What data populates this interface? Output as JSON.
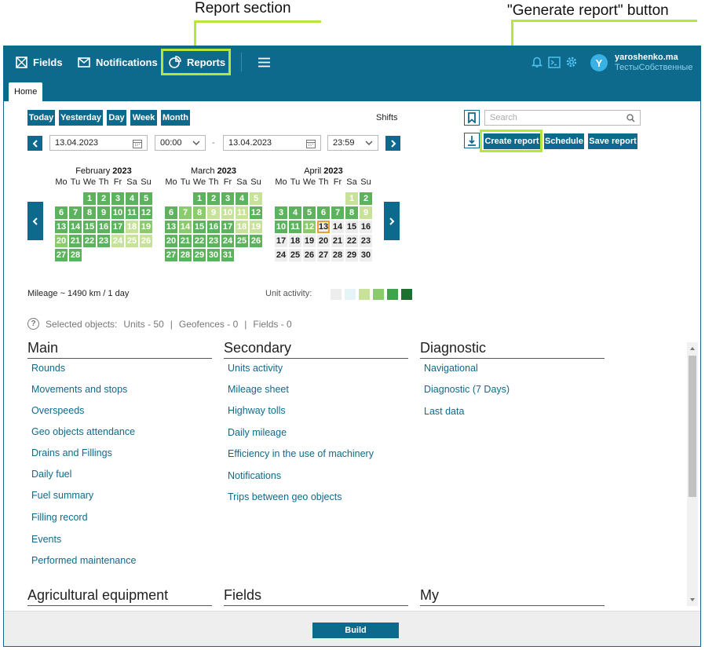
{
  "annotations": {
    "report_section": "Report section",
    "generate_button": "\"Generate report\" button"
  },
  "colors": {
    "brand": "#0e6a8c",
    "highlight": "#b6e53c",
    "activity_levels": [
      "#ededed",
      "#e4f4f7",
      "#c9e29a",
      "#8ccb6b",
      "#3ea34a",
      "#1f6f2f"
    ]
  },
  "topbar": {
    "nav": [
      {
        "label": "Fields",
        "icon": "fields-icon"
      },
      {
        "label": "Notifications",
        "icon": "envelope-icon"
      },
      {
        "label": "Reports",
        "icon": "pie-chart-icon"
      }
    ],
    "user": {
      "avatar": "Y",
      "name": "yaroshenko.ma",
      "subtitle": "ТестыСобственные"
    }
  },
  "tabs": {
    "home": "Home"
  },
  "period": {
    "buttons": [
      "Today",
      "Yesterday",
      "Day",
      "Week",
      "Month"
    ],
    "shifts": "Shifts",
    "from_date": "13.04.2023",
    "from_time": "00:00",
    "dash": "-",
    "to_date": "13.04.2023",
    "to_time": "23:59"
  },
  "search": {
    "placeholder": "Search"
  },
  "actions": {
    "create": "Create report",
    "schedule": "Schedule",
    "save": "Save report"
  },
  "calendar": {
    "weekdays": [
      "Mo",
      "Tu",
      "We",
      "Th",
      "Fr",
      "Sa",
      "Su"
    ],
    "months": [
      {
        "name": "February",
        "year": "2023",
        "offset": 2,
        "days": 28,
        "levels": [
          1,
          1,
          1,
          1,
          1,
          1,
          1,
          1,
          1,
          1,
          1,
          1,
          1,
          1,
          1,
          1,
          1,
          3,
          2,
          2,
          1,
          1,
          1,
          3,
          3,
          3,
          1,
          1
        ]
      },
      {
        "name": "March",
        "year": "2023",
        "offset": 2,
        "days": 31,
        "levels": [
          1,
          1,
          1,
          1,
          3,
          1,
          2,
          2,
          3,
          3,
          3,
          1,
          1,
          2,
          1,
          1,
          1,
          3,
          3,
          1,
          1,
          1,
          1,
          1,
          1,
          1,
          1,
          1,
          1,
          1,
          1
        ]
      },
      {
        "name": "April",
        "year": "2023",
        "offset": 5,
        "days": 30,
        "levels": [
          3,
          1,
          1,
          1,
          1,
          1,
          1,
          1,
          3,
          1,
          1,
          2,
          9,
          0,
          0,
          0,
          0,
          0,
          0,
          0,
          0,
          0,
          0,
          0,
          0,
          0,
          0,
          0,
          0,
          0
        ]
      }
    ]
  },
  "mileage": "Mileage ~ 1490 km / 1 day",
  "unit_activity": "Unit activity:",
  "selected": {
    "label": "Selected objects:",
    "units": "Units - 50",
    "sep": "|",
    "geofences": "Geofences - 0",
    "fields": "Fields - 0"
  },
  "reports": {
    "main": {
      "title": "Main",
      "items": [
        "Rounds",
        "Movements and stops",
        "Overspeeds",
        "Geo objects attendance",
        "Drains and Fillings",
        "Daily fuel",
        "Fuel summary",
        "Filling record",
        "Events",
        "Performed maintenance"
      ]
    },
    "secondary": {
      "title": "Secondary",
      "items": [
        "Units activity",
        "Mileage sheet",
        "Highway tolls",
        "Daily mileage",
        "Efficiency in the use of machinery",
        "Notifications",
        "Trips between geo objects"
      ]
    },
    "diagnostic": {
      "title": "Diagnostic",
      "items": [
        "Navigational",
        "Diagnostic (7 Days)",
        "Last data"
      ]
    },
    "agri": {
      "title": "Agricultural equipment"
    },
    "fields": {
      "title": "Fields"
    },
    "my": {
      "title": "My"
    }
  },
  "footer": {
    "build": "Build"
  }
}
